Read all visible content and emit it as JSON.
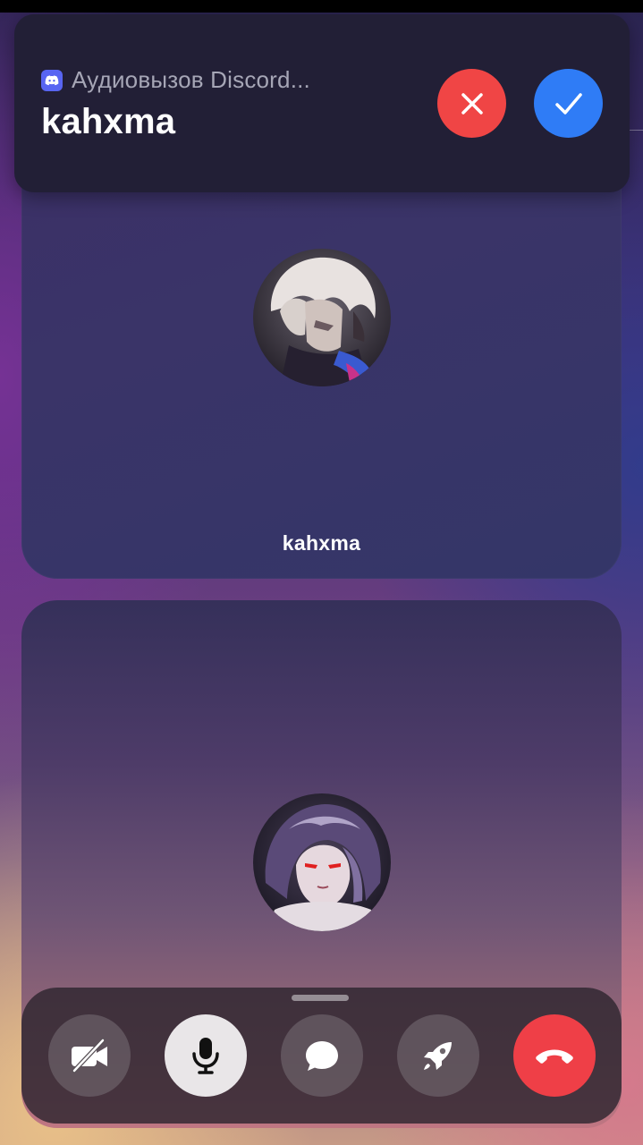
{
  "call_banner": {
    "app_label": "Аудиовызов Discord...",
    "caller_name": "kahxma",
    "app_icon": "discord-icon",
    "decline_icon": "close-icon",
    "accept_icon": "check-icon",
    "decline_color": "#f04545",
    "accept_color": "#2f7cf6"
  },
  "participants": [
    {
      "name": "kahxma",
      "avatar": "avatar-white-haired-anime"
    },
    {
      "name": "",
      "avatar": "avatar-dark-haired-anime"
    }
  ],
  "controls": [
    {
      "name": "camera-off",
      "icon": "camera-off-icon"
    },
    {
      "name": "microphone",
      "icon": "microphone-icon",
      "active": true
    },
    {
      "name": "chat",
      "icon": "chat-bubble-icon"
    },
    {
      "name": "activity",
      "icon": "rocket-icon"
    },
    {
      "name": "hang-up",
      "icon": "phone-hangup-icon",
      "color": "#ef3f47"
    }
  ]
}
